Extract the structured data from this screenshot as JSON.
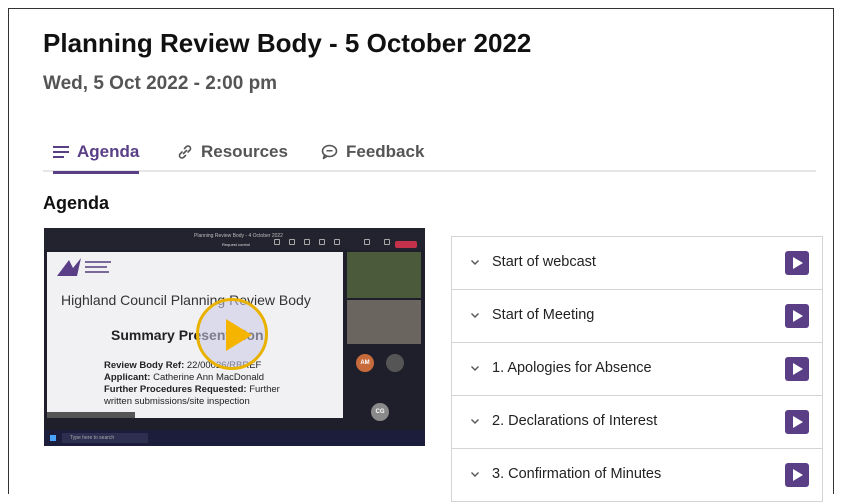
{
  "page": {
    "title": "Planning Review Body - 5 October 2022",
    "date": "Wed, 5 Oct 2022 - 2:00 pm"
  },
  "tabs": [
    {
      "label": "Agenda",
      "icon": "list-icon",
      "active": true
    },
    {
      "label": "Resources",
      "icon": "link-icon",
      "active": false
    },
    {
      "label": "Feedback",
      "icon": "chat-icon",
      "active": false
    }
  ],
  "section_heading": "Agenda",
  "video": {
    "window_title": "Planning Review Body - 4 October 2022",
    "request_control": "Request control",
    "slide": {
      "heading": "Highland Council Planning Review Body",
      "subheading": "Summary Presentation",
      "ref_label": "Review Body Ref:",
      "ref_value": "22/00026/RBREF",
      "applicant_label": "Applicant:",
      "applicant_value": "Catherine Ann MacDonald",
      "procedures_label": "Further Procedures Requested:",
      "procedures_value": "Further",
      "procedures_value2": "written submissions/site inspection"
    },
    "participants": [
      {
        "initials": "AM",
        "color": "#c86b3c"
      },
      {
        "initials": "CG",
        "color": "#8a8a8a"
      }
    ],
    "taskbar_search": "Type here to search",
    "play_color": "#f5b400"
  },
  "agenda_items": [
    {
      "label": "Start of webcast"
    },
    {
      "label": "Start of Meeting"
    },
    {
      "label": "1. Apologies for Absence"
    },
    {
      "label": "2. Declarations of Interest"
    },
    {
      "label": "3. Confirmation of Minutes"
    }
  ],
  "colors": {
    "accent": "#5a3f86",
    "tab_inactive": "#555555"
  }
}
